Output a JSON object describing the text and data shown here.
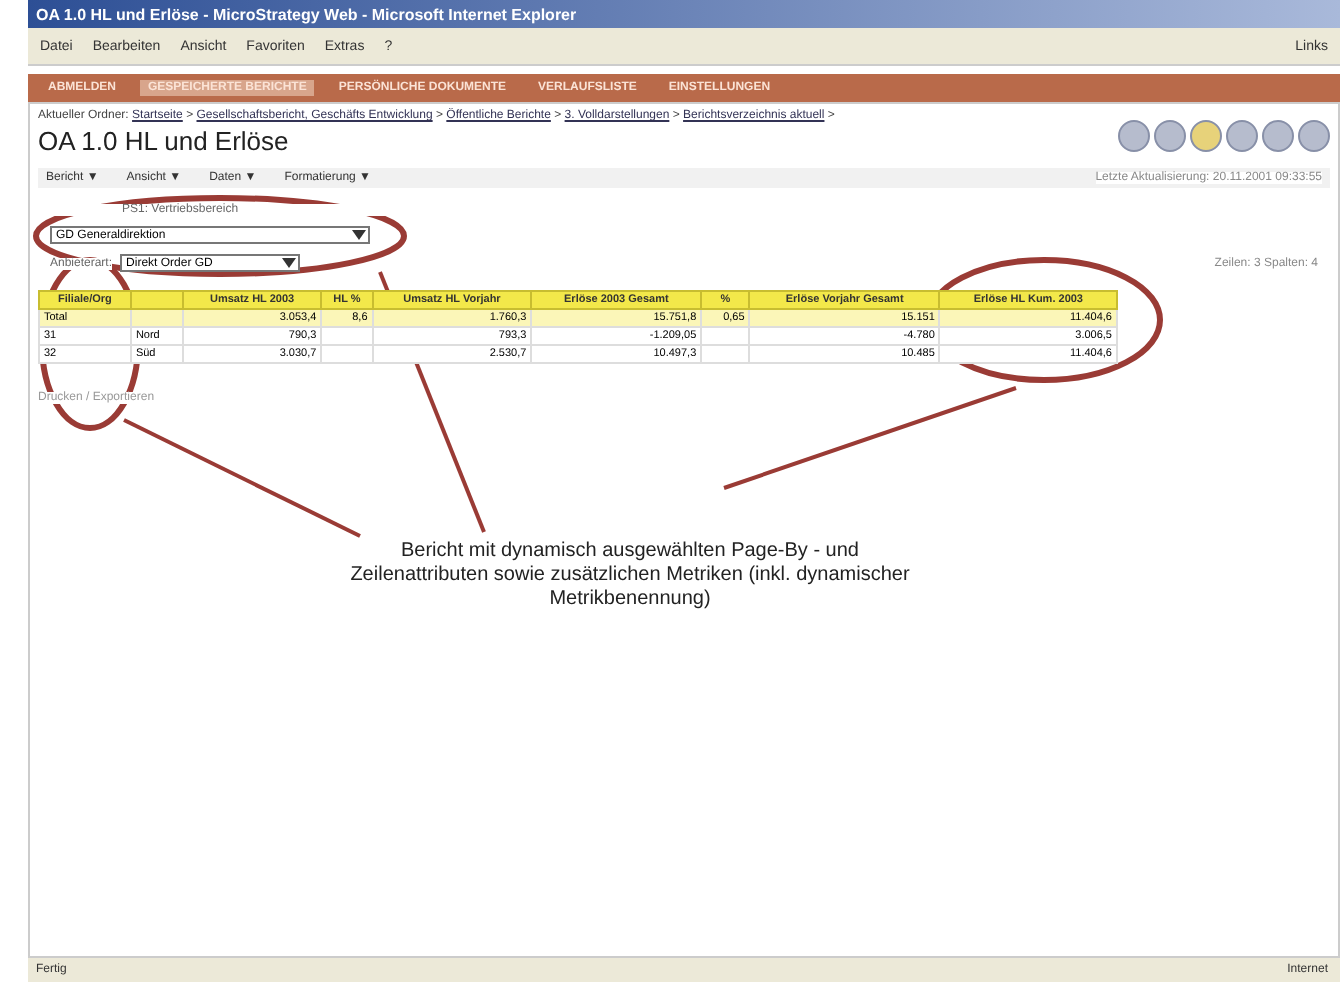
{
  "window": {
    "title": "OA 1.0 HL und Erlöse - MicroStrategy Web - Microsoft Internet Explorer"
  },
  "menu": [
    "Datei",
    "Bearbeiten",
    "Ansicht",
    "Favoriten",
    "Extras",
    "?"
  ],
  "links_label": "Links",
  "nav_tabs": [
    {
      "label": "ABMELDEN",
      "selected": false
    },
    {
      "label": "GESPEICHERTE BERICHTE",
      "selected": true
    },
    {
      "label": "PERSÖNLICHE DOKUMENTE",
      "selected": false
    },
    {
      "label": "VERLAUFSLISTE",
      "selected": false
    },
    {
      "label": "EINSTELLUNGEN",
      "selected": false
    }
  ],
  "breadcrumb": {
    "label": "Aktueller Ordner:",
    "separator": ">",
    "items": [
      "Startseite",
      "Gesellschaftsbericht, Geschäfts Entwicklung",
      "Öffentliche Berichte",
      "3. Volldarstellungen",
      "Berichtsverzeichnis aktuell"
    ]
  },
  "report_title": "OA 1.0 HL und Erlöse",
  "toolbar_icons": [
    {
      "selected": false
    },
    {
      "selected": false
    },
    {
      "selected": true
    },
    {
      "selected": false
    },
    {
      "selected": false
    },
    {
      "selected": false
    }
  ],
  "report_menu": [
    "Bericht ▼",
    "Ansicht ▼",
    "Daten ▼",
    "Formatierung ▼"
  ],
  "last_update": "Letzte Aktualisierung: 20.11.2001 09:33:55",
  "page_by": {
    "label": "PS1: Vertriebsbereich",
    "value": "GD Generaldirektion"
  },
  "attribute_select": {
    "label": "Anbieterart:",
    "value": "Direkt Order GD"
  },
  "grid_info": "Zeilen: 3  Spalten: 4",
  "table": {
    "columns": [
      "Filiale/Org",
      "",
      "Umsatz HL 2003",
      "HL %",
      "Umsatz HL Vorjahr",
      "Erlöse 2003 Gesamt",
      "%",
      "Erlöse Vorjahr Gesamt",
      "Erlöse HL Kum. 2003"
    ],
    "rows": [
      [
        "Total",
        "",
        "3.053,4",
        "8,6",
        "1.760,3",
        "15.751,8",
        "0,65",
        "15.151",
        "11.404,6"
      ],
      [
        "31",
        "Nord",
        "790,3",
        "",
        "793,3",
        "-1.209,05",
        "",
        "-4.780",
        "3.006,5"
      ],
      [
        "32",
        "Süd",
        "3.030,7",
        "",
        "2.530,7",
        "10.497,3",
        "",
        "10.485",
        "11.404,6"
      ]
    ]
  },
  "footer_link": "Drucken / Exportieren",
  "annotation": "Bericht mit dynamisch ausgewählten Page-By - und Zeilenattributen sowie zusätzlichen Metriken (inkl. dynamischer Metrikbenennung)",
  "status_bar": {
    "text": "Fertig",
    "zone": "Internet"
  }
}
